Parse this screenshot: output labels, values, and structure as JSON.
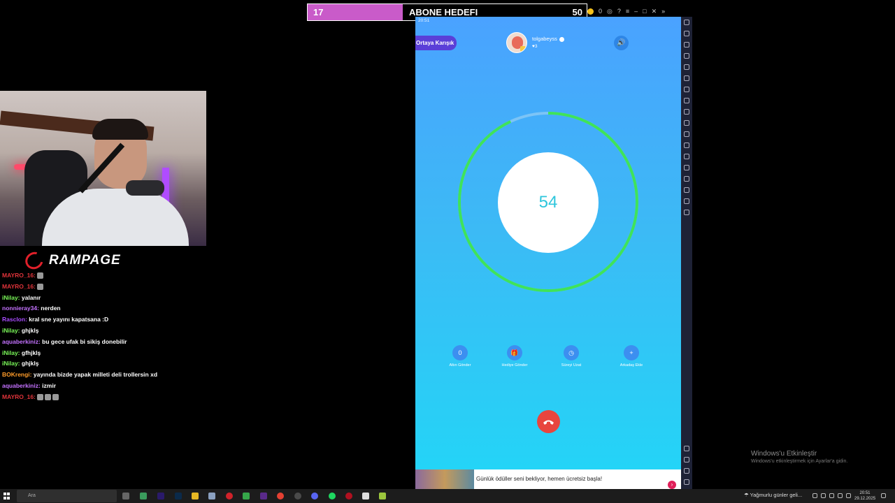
{
  "goal": {
    "current": "17",
    "title": "ABONE HEDEFI",
    "target": "50",
    "progress_fraction": 0.34
  },
  "emulator": {
    "coins": "0"
  },
  "brand": {
    "name": "RAMPAGE"
  },
  "chat": [
    {
      "user": "MAYRO_16:",
      "color": "#e0333a",
      "text": "",
      "emotes": 1
    },
    {
      "user": "MAYRO_16:",
      "color": "#e0333a",
      "text": "",
      "emotes": 1
    },
    {
      "user": "iNilay:",
      "color": "#7cfc5a",
      "text": "yalanır",
      "emotes": 0
    },
    {
      "user": "nonnieray34:",
      "color": "#c472ff",
      "text": "nerden",
      "emotes": 0
    },
    {
      "user": "Rasclon:",
      "color": "#a94cff",
      "text": "kral sne yayını kapatsana :D",
      "emotes": 0
    },
    {
      "user": "iNilay:",
      "color": "#7cfc5a",
      "text": "ghjklş",
      "emotes": 0
    },
    {
      "user": "aquaberkiniz:",
      "color": "#c472ff",
      "text": "bu gece ufak bi sikiş donebilir",
      "emotes": 0
    },
    {
      "user": "iNilay:",
      "color": "#7cfc5a",
      "text": "gfhjklş",
      "emotes": 0
    },
    {
      "user": "iNilay:",
      "color": "#7cfc5a",
      "text": "ghjklş",
      "emotes": 0
    },
    {
      "user": "BOKrengi:",
      "color": "#ff9c2a",
      "text": "yayında bizde yapak milleti deli trollersin xd",
      "emotes": 0
    },
    {
      "user": "aquaberkiniz:",
      "color": "#c472ff",
      "text": "izmir",
      "emotes": 0
    },
    {
      "user": "MAYRO_16:",
      "color": "#e0333a",
      "text": "",
      "emotes": 3
    }
  ],
  "app": {
    "status_time": "20:51",
    "mix_button": "Ortaya Karışık",
    "username": "tolgabeyss",
    "likes": "3",
    "timer": "54",
    "timer_progress_fraction": 0.93,
    "actions": [
      {
        "icon": "0",
        "label": "Altın Gönder"
      },
      {
        "icon": "gift-icon",
        "label": "Hediye Gönder"
      },
      {
        "icon": "clock-icon",
        "label": "Süreyi Uzat"
      },
      {
        "icon": "plus-icon",
        "label": "Arkadaş Ekle"
      }
    ],
    "ad_text": "Günlük ödüller seni bekliyor, hemen ücretsiz başla!"
  },
  "windows": {
    "watermark_title": "Windows'u Etkinleştir",
    "watermark_sub": "Windows'u etkinleştirmek için Ayarlar'a gidin.",
    "search_text": "Ara",
    "weather": "Yağmurlu günler geli...",
    "time": "20:51",
    "date": "29.12.2025"
  },
  "colors": {
    "accent_purple": "#5a3fd8",
    "ring_green": "#3fe35a",
    "hangup_red": "#e8453e",
    "goal_fill": "#c95bc9"
  }
}
